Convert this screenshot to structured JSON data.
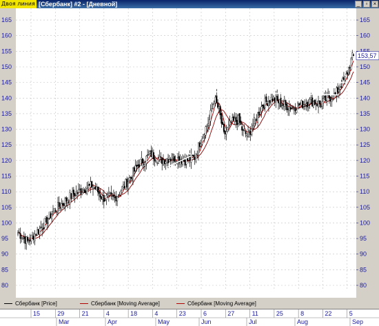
{
  "window": {
    "tag": "Двоя линия",
    "title": "[Сбербанк] #2 - [Дневной]"
  },
  "legend": [
    {
      "label": "Сбербанк [Price]",
      "color": "#000000"
    },
    {
      "label": "Сбербанк [Moving Average]",
      "color": "#b00000"
    },
    {
      "label": "Сбербанк [Moving Average]",
      "color": "#b00000"
    }
  ],
  "price_tag": "153,57",
  "chart_data": {
    "type": "candlestick",
    "y_ticks": [
      "80",
      "85",
      "90",
      "95",
      "100",
      "105",
      "110",
      "115",
      "120",
      "125",
      "130",
      "135",
      "140",
      "145",
      "150",
      "155",
      "160",
      "165"
    ],
    "ylim": [
      80,
      167
    ],
    "day_labels": [
      "15",
      "29",
      "21",
      "4",
      "18",
      "4",
      "23",
      "6",
      "27",
      "11",
      "25",
      "8",
      "22",
      "5"
    ],
    "month_labels": [
      "Mar",
      "Apr",
      "May",
      "Jun",
      "Jul",
      "Aug",
      "Sep"
    ],
    "last_price": 153.57,
    "price_anchors": [
      [
        0,
        97
      ],
      [
        8,
        94
      ],
      [
        18,
        98
      ],
      [
        30,
        104
      ],
      [
        45,
        109
      ],
      [
        55,
        111
      ],
      [
        62,
        112
      ],
      [
        70,
        108
      ],
      [
        80,
        108
      ],
      [
        90,
        113
      ],
      [
        100,
        119
      ],
      [
        110,
        122
      ],
      [
        118,
        120
      ],
      [
        128,
        121
      ],
      [
        138,
        120
      ],
      [
        146,
        121
      ],
      [
        152,
        128
      ],
      [
        158,
        133
      ],
      [
        162,
        140
      ],
      [
        166,
        136
      ],
      [
        170,
        128
      ],
      [
        176,
        132
      ],
      [
        182,
        133
      ],
      [
        186,
        129
      ],
      [
        190,
        128
      ],
      [
        196,
        133
      ],
      [
        202,
        138
      ],
      [
        210,
        140
      ],
      [
        218,
        138
      ],
      [
        226,
        137
      ],
      [
        234,
        138
      ],
      [
        242,
        139
      ],
      [
        250,
        138
      ],
      [
        256,
        140
      ],
      [
        262,
        141
      ],
      [
        266,
        144
      ],
      [
        270,
        146
      ],
      [
        276,
        153
      ]
    ],
    "trendlines": [
      {
        "from": [
          117,
          125.5
        ],
        "to": [
          143,
          122
        ]
      },
      {
        "from": [
          124,
          118
        ],
        "to": [
          143,
          121.5
        ]
      },
      {
        "from": [
          163,
          142
        ]
      },
      {
        "from": [
          163,
          142
        ],
        "to": [
          265,
          141
        ]
      },
      {
        "from": [
          185,
          125
        ],
        "to": [
          258,
          136
        ]
      },
      {
        "from": [
          262,
          145
        ],
        "to": [
          270,
          145
        ]
      }
    ]
  }
}
